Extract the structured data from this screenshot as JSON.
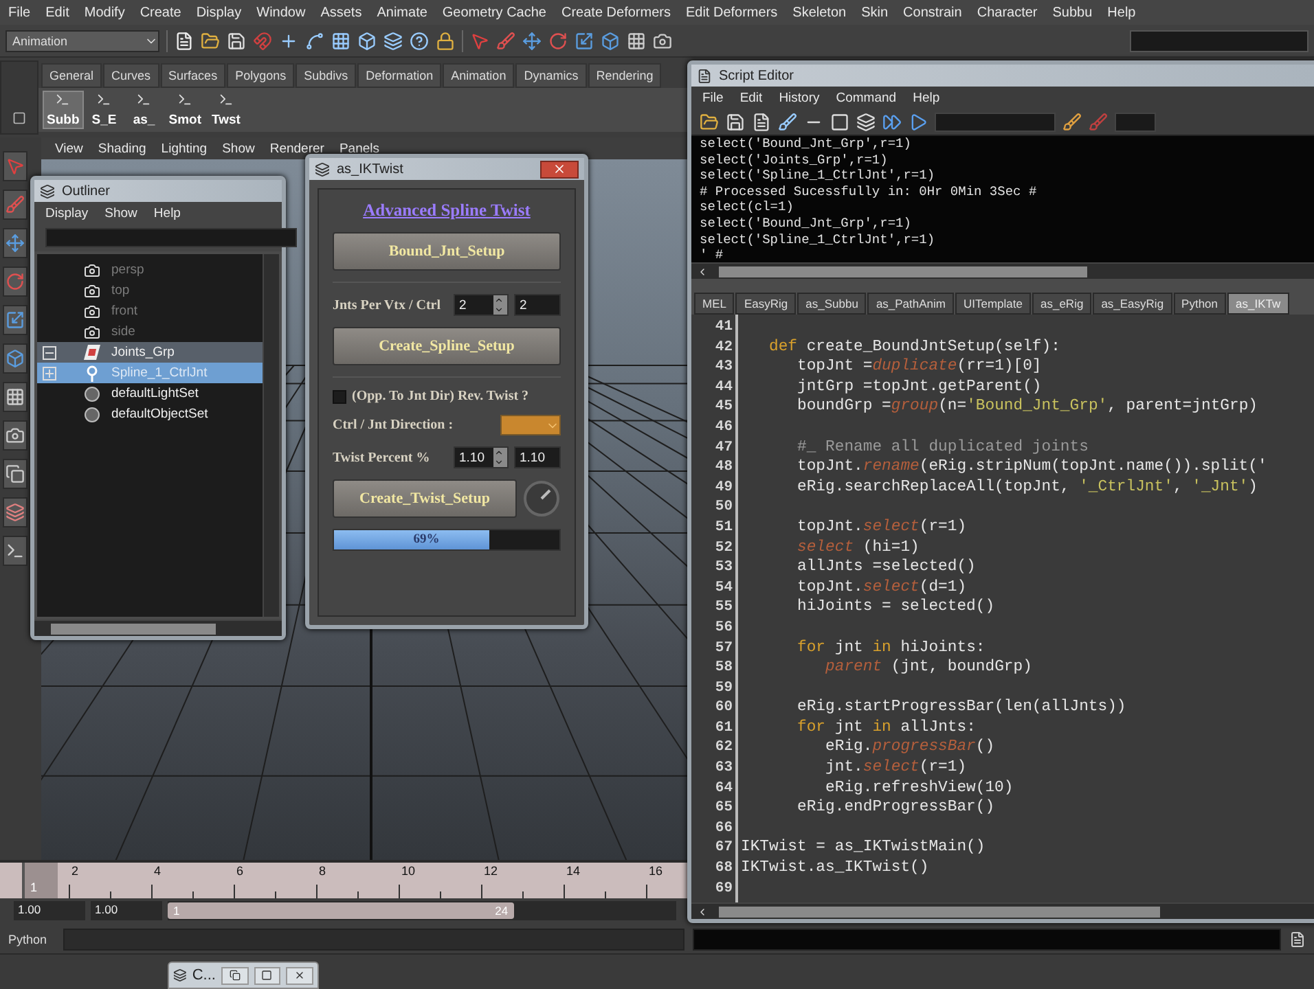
{
  "menu_bar": [
    "File",
    "Edit",
    "Modify",
    "Create",
    "Display",
    "Window",
    "Assets",
    "Animate",
    "Geometry Cache",
    "Create Deformers",
    "Edit Deformers",
    "Skeleton",
    "Skin",
    "Constrain",
    "Character",
    "Subbu",
    "Help"
  ],
  "mode_selector": {
    "value": "Animation"
  },
  "shelf_tabs": [
    "General",
    "Curves",
    "Surfaces",
    "Polygons",
    "Subdivs",
    "Deformation",
    "Animation",
    "Dynamics",
    "Rendering"
  ],
  "shelf_buttons": [
    {
      "label": "Subb",
      "selected": true
    },
    {
      "label": "S_E",
      "selected": false
    },
    {
      "label": "as_",
      "selected": false
    },
    {
      "label": "Smot",
      "selected": false
    },
    {
      "label": "Twst",
      "selected": false
    }
  ],
  "panel_menu": [
    "View",
    "Shading",
    "Lighting",
    "Show",
    "Renderer",
    "Panels"
  ],
  "outliner": {
    "title": "Outliner",
    "menu": [
      "Display",
      "Show",
      "Help"
    ],
    "items": [
      {
        "kind": "camera",
        "label": "persp",
        "dimmed": true,
        "selected": false
      },
      {
        "kind": "camera",
        "label": "top",
        "dimmed": true,
        "selected": false
      },
      {
        "kind": "camera",
        "label": "front",
        "dimmed": true,
        "selected": false
      },
      {
        "kind": "camera",
        "label": "side",
        "dimmed": true,
        "selected": false
      },
      {
        "kind": "group",
        "label": "Joints_Grp",
        "dimmed": false,
        "selected": false,
        "highlighted": true,
        "expanded": true
      },
      {
        "kind": "joint",
        "label": "Spline_1_CtrlJnt",
        "dimmed": false,
        "selected": true,
        "expanded": false
      },
      {
        "kind": "set",
        "label": "defaultLightSet",
        "dimmed": false,
        "selected": false
      },
      {
        "kind": "set",
        "label": "defaultObjectSet",
        "dimmed": false,
        "selected": false
      }
    ]
  },
  "ik_twist": {
    "title": "as_IKTwist",
    "heading": "Advanced Spline Twist",
    "bound_button": "Bound_Jnt_Setup",
    "joints_label": "Jnts Per Vtx / Ctrl",
    "joints_value": "2",
    "joints_value_2": "2",
    "spline_button": "Create_Spline_Setup",
    "reverse_twist": {
      "label": "(Opp. To Jnt Dir) Rev. Twist ?",
      "checked": false
    },
    "direction_label": "Ctrl / Jnt Direction :",
    "twist_label": "Twist Percent %",
    "twist_value": "1.10",
    "twist_value_2": "1.10",
    "twist_button": "Create_Twist_Setup",
    "progress": {
      "level": 0.69,
      "label": "69%"
    }
  },
  "script_editor": {
    "title": "Script Editor",
    "menu": [
      "File",
      "Edit",
      "History",
      "Command",
      "Help"
    ],
    "history": [
      "select('Bound_Jnt_Grp',r=1)",
      "select('Joints_Grp',r=1)",
      "select('Spline_1_CtrlJnt',r=1)",
      "# Processed Sucessfully in: 0Hr 0Min 3Sec #",
      "select(cl=1)",
      "select('Bound_Jnt_Grp',r=1)",
      "select('Spline_1_CtrlJnt',r=1)",
      "' #"
    ],
    "tabs": [
      {
        "label": "MEL",
        "selected": false
      },
      {
        "label": "EasyRig",
        "selected": false
      },
      {
        "label": "as_Subbu",
        "selected": false
      },
      {
        "label": "as_PathAnim",
        "selected": false
      },
      {
        "label": "UITemplate",
        "selected": false
      },
      {
        "label": "as_eRig",
        "selected": false
      },
      {
        "label": "as_EasyRig",
        "selected": false
      },
      {
        "label": "Python",
        "selected": false
      },
      {
        "label": "as_IKTw",
        "selected": true
      }
    ],
    "code": [
      {
        "number": "41"
      },
      {
        "number": "42",
        "segments": [
          {
            "kind": "keyword",
            "text": "   def"
          },
          {
            "kind": "plain",
            "text": " create_BoundJntSetup(self):"
          }
        ]
      },
      {
        "number": "43",
        "segments": [
          {
            "kind": "plain",
            "text": "      topJnt ="
          },
          {
            "kind": "builtin",
            "text": "duplicate"
          },
          {
            "kind": "plain",
            "text": "(rr=1)[0]"
          }
        ]
      },
      {
        "number": "44",
        "segments": [
          {
            "kind": "plain",
            "text": "      jntGrp =topJnt.getParent()"
          }
        ]
      },
      {
        "number": "45",
        "segments": [
          {
            "kind": "plain",
            "text": "      boundGrp ="
          },
          {
            "kind": "builtin",
            "text": "group"
          },
          {
            "kind": "plain",
            "text": "(n="
          },
          {
            "kind": "string",
            "text": "'Bound_Jnt_Grp'"
          },
          {
            "kind": "plain",
            "text": ", parent=jntGrp)"
          }
        ]
      },
      {
        "number": "46"
      },
      {
        "number": "47",
        "segments": [
          {
            "kind": "comment",
            "text": "      #_ Rename all duplicated joints"
          }
        ]
      },
      {
        "number": "48",
        "segments": [
          {
            "kind": "plain",
            "text": "      topJnt."
          },
          {
            "kind": "builtin",
            "text": "rename"
          },
          {
            "kind": "plain",
            "text": "(eRig.stripNum(topJnt.name()).split('"
          }
        ]
      },
      {
        "number": "49",
        "segments": [
          {
            "kind": "plain",
            "text": "      eRig.searchReplaceAll(topJnt, "
          },
          {
            "kind": "string",
            "text": "'_CtrlJnt'"
          },
          {
            "kind": "plain",
            "text": ", "
          },
          {
            "kind": "string",
            "text": "'_Jnt'"
          },
          {
            "kind": "plain",
            "text": ")"
          }
        ]
      },
      {
        "number": "50"
      },
      {
        "number": "51",
        "segments": [
          {
            "kind": "plain",
            "text": "      topJnt."
          },
          {
            "kind": "builtin",
            "text": "select"
          },
          {
            "kind": "plain",
            "text": "(r=1)"
          }
        ]
      },
      {
        "number": "52",
        "segments": [
          {
            "kind": "builtin",
            "text": "      select"
          },
          {
            "kind": "plain",
            "text": " (hi=1)"
          }
        ]
      },
      {
        "number": "53",
        "segments": [
          {
            "kind": "plain",
            "text": "      allJnts =selected()"
          }
        ]
      },
      {
        "number": "54",
        "segments": [
          {
            "kind": "plain",
            "text": "      topJnt."
          },
          {
            "kind": "builtin",
            "text": "select"
          },
          {
            "kind": "plain",
            "text": "(d=1)"
          }
        ]
      },
      {
        "number": "55",
        "segments": [
          {
            "kind": "plain",
            "text": "      hiJoints = selected()"
          }
        ]
      },
      {
        "number": "56"
      },
      {
        "number": "57",
        "segments": [
          {
            "kind": "keyword",
            "text": "      for"
          },
          {
            "kind": "plain",
            "text": " jnt "
          },
          {
            "kind": "keyword",
            "text": "in"
          },
          {
            "kind": "plain",
            "text": " hiJoints:"
          }
        ]
      },
      {
        "number": "58",
        "segments": [
          {
            "kind": "builtin",
            "text": "         parent"
          },
          {
            "kind": "plain",
            "text": " (jnt, boundGrp)"
          }
        ]
      },
      {
        "number": "59"
      },
      {
        "number": "60",
        "segments": [
          {
            "kind": "plain",
            "text": "      eRig.startProgressBar(len(allJnts))"
          }
        ]
      },
      {
        "number": "61",
        "segments": [
          {
            "kind": "keyword",
            "text": "      for"
          },
          {
            "kind": "plain",
            "text": " jnt "
          },
          {
            "kind": "keyword",
            "text": "in"
          },
          {
            "kind": "plain",
            "text": " allJnts:"
          }
        ]
      },
      {
        "number": "62",
        "segments": [
          {
            "kind": "plain",
            "text": "         eRig."
          },
          {
            "kind": "builtin",
            "text": "progressBar"
          },
          {
            "kind": "plain",
            "text": "()"
          }
        ]
      },
      {
        "number": "63",
        "segments": [
          {
            "kind": "plain",
            "text": "         jnt."
          },
          {
            "kind": "builtin",
            "text": "select"
          },
          {
            "kind": "plain",
            "text": "(r=1)"
          }
        ]
      },
      {
        "number": "64",
        "segments": [
          {
            "kind": "plain",
            "text": "         eRig.refreshView(10)"
          }
        ]
      },
      {
        "number": "65",
        "segments": [
          {
            "kind": "plain",
            "text": "      eRig.endProgressBar()"
          }
        ]
      },
      {
        "number": "66"
      },
      {
        "number": "67",
        "segments": [
          {
            "kind": "plain",
            "text": "IKTwist = as_IKTwistMain()"
          }
        ]
      },
      {
        "number": "68",
        "segments": [
          {
            "kind": "plain",
            "text": "IKTwist.as_IKTwist()"
          }
        ]
      },
      {
        "number": "69"
      }
    ]
  },
  "time_slider": {
    "current": "1",
    "level": 0,
    "ticks": [
      "2",
      "4",
      "6",
      "8",
      "10",
      "12",
      "14",
      "16"
    ]
  },
  "range": {
    "start": "1.00",
    "playback_start": "1.00",
    "range_start": "1",
    "range_end": "24",
    "level": 0.68
  },
  "command_line": {
    "language": "Python"
  },
  "minimized_window": {
    "title": "C..."
  }
}
